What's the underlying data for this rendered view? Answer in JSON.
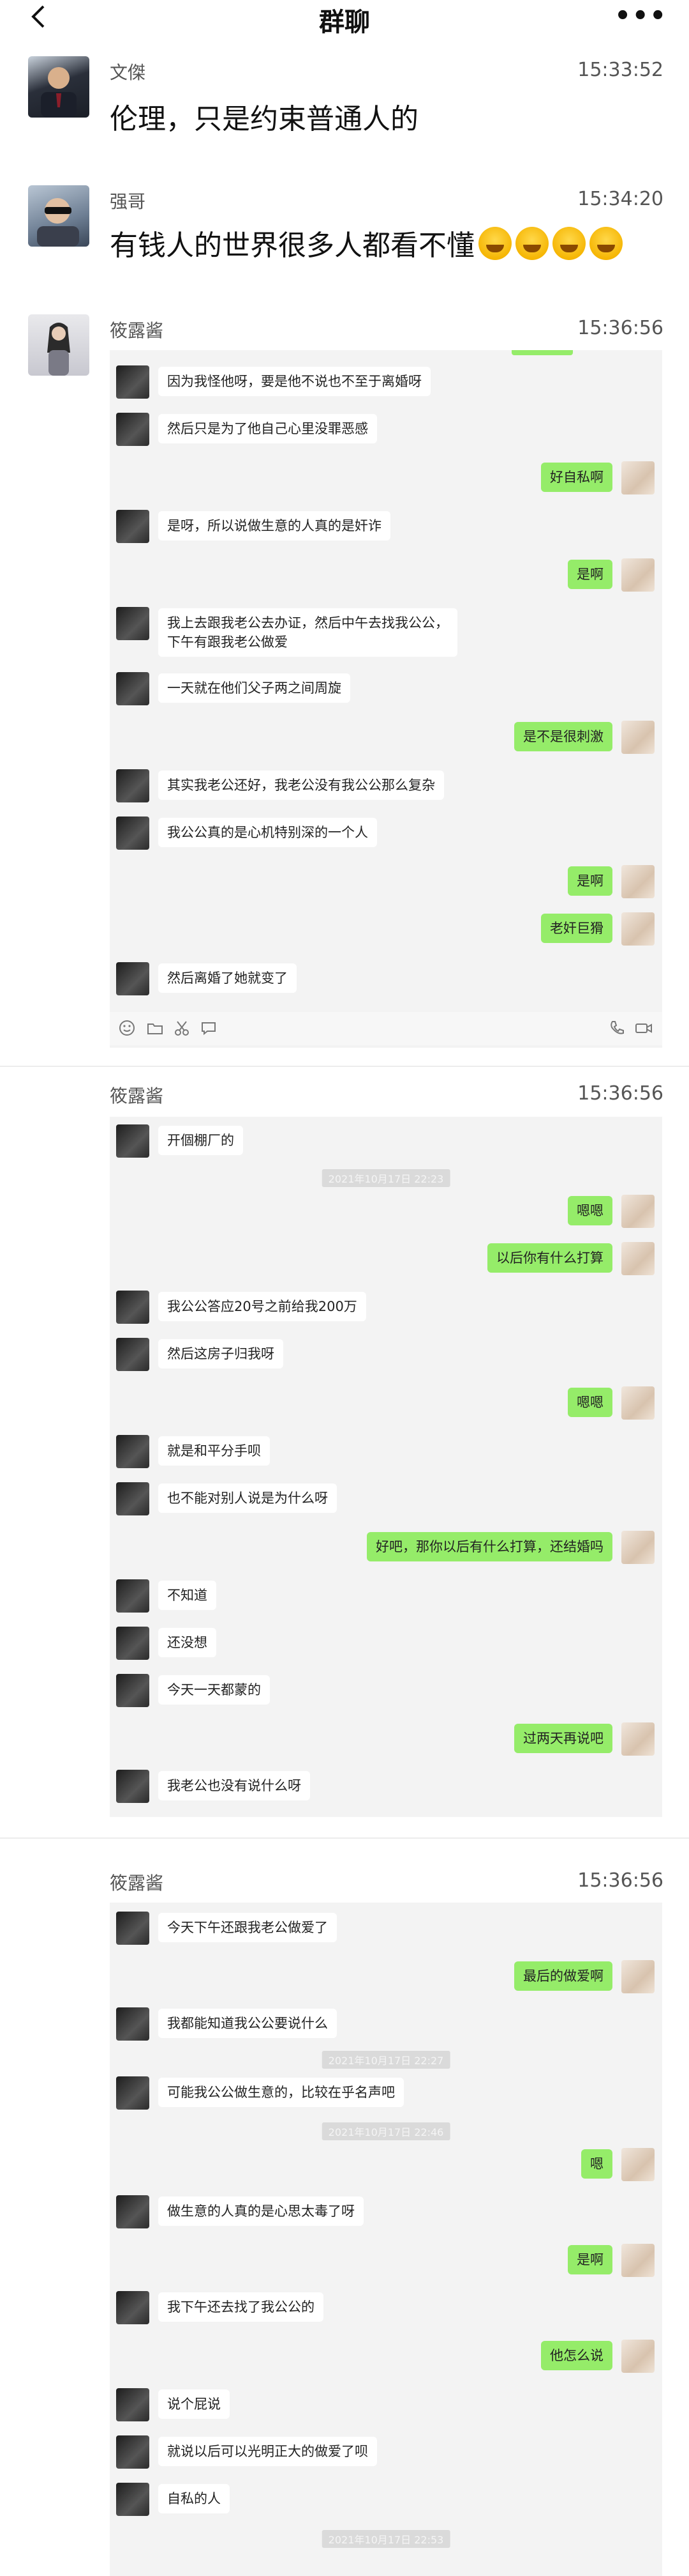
{
  "header": {
    "title": "群聊"
  },
  "messages": [
    {
      "sender": "文傑",
      "time": "15:33:52",
      "text": "伦理，只是约束普通人的"
    },
    {
      "sender": "强哥",
      "time": "15:34:20",
      "text": "有钱人的世界很多人都看不懂",
      "emoji": "laughing-tears-emoji x4"
    },
    {
      "sender": "筱露酱",
      "time": "15:36:56"
    },
    {
      "sender": "筱露酱",
      "time": "15:36:56"
    },
    {
      "sender": "筱露酱",
      "time": "15:36:56"
    }
  ],
  "shot1": [
    "因为我怪他呀，要是他不说也不至于离婚呀",
    "然后只是为了他自己心里没罪恶感",
    "好自私啊",
    "是呀，所以说做生意的人真的是奸诈",
    "是啊",
    "我上去跟我老公去办证，然后中午去找我公公，",
    "下午有跟我老公做爱",
    "一天就在他们父子两之间周旋",
    "是不是很刺激",
    "其实我老公还好，我老公没有我公公那么复杂",
    "我公公真的是心机特别深的一个人",
    "是啊",
    "老奸巨猾",
    "然后离婚了她就变了"
  ],
  "shot2": [
    "开個棚厂的",
    "2021年10月17日 22:23",
    "嗯嗯",
    "以后你有什么打算",
    "我公公答应20号之前给我200万",
    "然后这房子归我呀",
    "嗯嗯",
    "就是和平分手呗",
    "也不能对别人说是为什么呀",
    "好吧，那你以后有什么打算，还结婚吗",
    "不知道",
    "还没想",
    "今天一天都蒙的",
    "过两天再说吧",
    "我老公也没有说什么呀"
  ],
  "shot3": [
    "今天下午还跟我老公做爱了",
    "最后的做爱啊",
    "我都能知道我公公要说什么",
    "2021年10月17日 22:27",
    "可能我公公做生意的，比较在乎名声吧",
    "2021年10月17日 22:46",
    "嗯",
    "做生意的人真的是心思太毒了呀",
    "是啊",
    "我下午还去找了我公公的",
    "他怎么说",
    "说个屁说",
    "就说以后可以光明正大的做爱了呗",
    "自私的人",
    "2021年10月17日 22:53"
  ]
}
